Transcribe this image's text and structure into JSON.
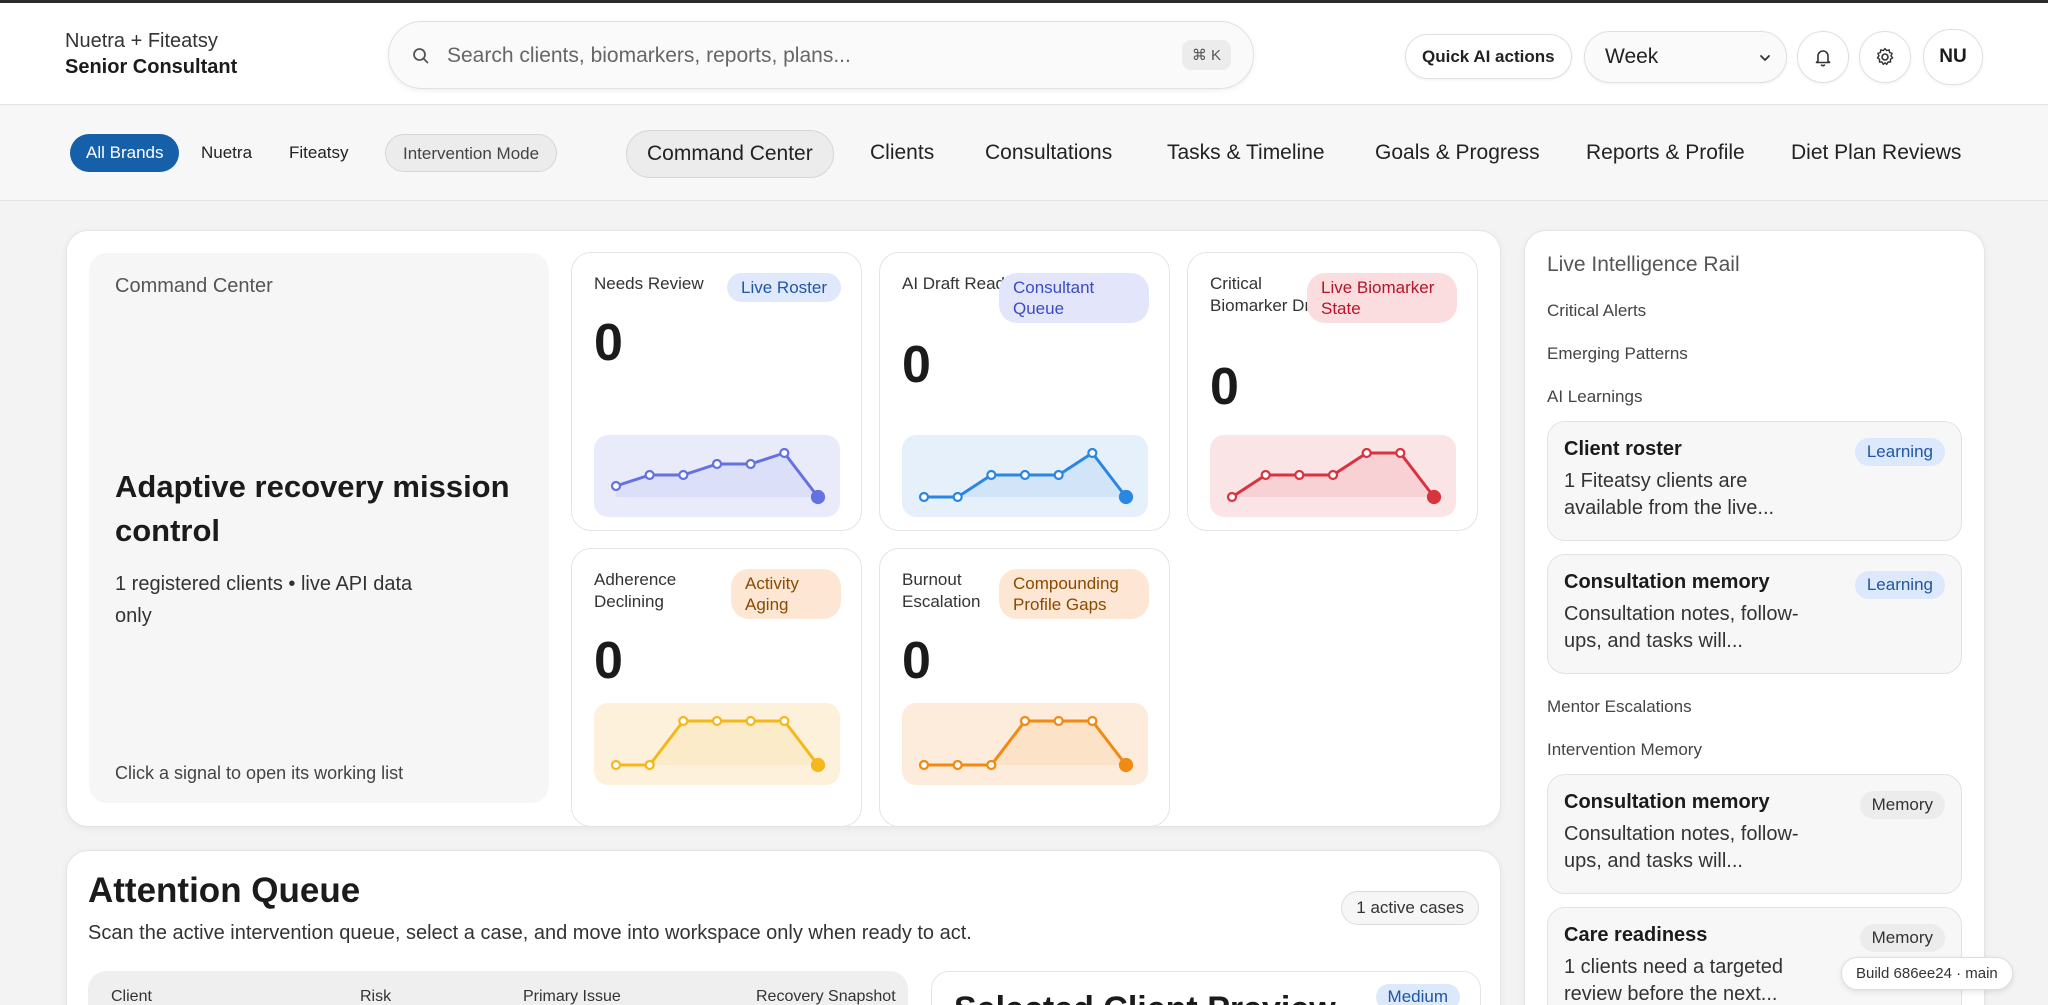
{
  "header": {
    "brand_line1": "Nuetra + Fiteatsy",
    "brand_line2": "Senior Consultant",
    "search_placeholder": "Search clients, biomarkers, reports, plans...",
    "search_shortcut": "⌘ K",
    "quick_actions_label": "Quick AI actions",
    "period_select": "Week",
    "avatar_initials": "NU",
    "icons": [
      "search-icon",
      "chevron-down-icon",
      "bell-icon",
      "gear-icon"
    ]
  },
  "nav": {
    "brands": [
      "All Brands",
      "Nuetra",
      "Fiteatsy"
    ],
    "mode_label": "Intervention Mode",
    "tabs": [
      "Command Center",
      "Clients",
      "Consultations",
      "Tasks & Timeline",
      "Goals & Progress",
      "Reports & Profile",
      "Diet Plan Reviews"
    ],
    "active_tab": "Command Center",
    "accent_color": "#1560a8"
  },
  "command_center": {
    "label": "Command Center",
    "title": "Adaptive recovery mission control",
    "subtitle": "1 registered clients • live API data only",
    "footer": "Click a signal to open its working list",
    "signals": [
      {
        "title": "Needs Review",
        "badge": "Live Roster",
        "value": "0",
        "color": "#6571e0",
        "fill": "#e9ebfb",
        "badge_bg": "#dfe9fb",
        "badge_fg": "#1f56a4",
        "trend": [
          1,
          2,
          2,
          3,
          3,
          4,
          0
        ]
      },
      {
        "title": "AI Draft Ready",
        "badge": "Consultant Queue",
        "value": "0",
        "color": "#2a86e0",
        "fill": "#e6f0fb",
        "badge_bg": "#e3e6fb",
        "badge_fg": "#3a4bc9",
        "trend": [
          0,
          0,
          1,
          1,
          1,
          2,
          0
        ]
      },
      {
        "title": "Critical Biomarker Drift",
        "badge": "Live Biomarker State",
        "value": "0",
        "color": "#d8343f",
        "fill": "#fbe4e6",
        "badge_bg": "#fbdde0",
        "badge_fg": "#b3152a",
        "trend": [
          0,
          1,
          1,
          1,
          2,
          2,
          0
        ]
      },
      {
        "title": "Adherence Declining",
        "badge": "Activity Aging",
        "value": "0",
        "color": "#f4b81c",
        "fill": "#fdf1dc",
        "badge_bg": "#fde6d3",
        "badge_fg": "#8a4a00",
        "trend": [
          0,
          0,
          1,
          1,
          1,
          1,
          0
        ]
      },
      {
        "title": "Burnout Escalation",
        "badge": "Compounding Profile Gaps",
        "value": "0",
        "color": "#f18a12",
        "fill": "#fdecdc",
        "badge_bg": "#fde6d3",
        "badge_fg": "#8a4a00",
        "trend": [
          0,
          0,
          0,
          1,
          1,
          1,
          0
        ]
      }
    ]
  },
  "attention_queue": {
    "title": "Attention Queue",
    "subtitle": "Scan the active intervention queue, select a case, and move into workspace only when ready to act.",
    "count_badge": "1 active cases",
    "columns": [
      "Client",
      "Risk",
      "Primary Issue",
      "Recovery Snapshot"
    ],
    "preview_title": "Selected Client Preview",
    "preview_badge": "Medium"
  },
  "rail": {
    "title": "Live Intelligence Rail",
    "sections": {
      "critical_alerts": "Critical Alerts",
      "emerging_patterns": "Emerging Patterns",
      "ai_learnings": "AI Learnings",
      "mentor_escalations": "Mentor Escalations",
      "intervention_memory": "Intervention Memory"
    },
    "learning_items": [
      {
        "title": "Client roster",
        "body": "1 Fiteatsy clients are available from the live...",
        "badge": "Learning"
      },
      {
        "title": "Consultation memory",
        "body": "Consultation notes, follow-ups, and tasks will...",
        "badge": "Learning"
      }
    ],
    "memory_items": [
      {
        "title": "Consultation memory",
        "body": "Consultation notes, follow-ups, and tasks will...",
        "badge": "Memory"
      },
      {
        "title": "Care readiness",
        "body": "1 clients need a targeted review before the next...",
        "badge": "Memory"
      }
    ]
  },
  "build_tag": "Build 686ee24 · main"
}
